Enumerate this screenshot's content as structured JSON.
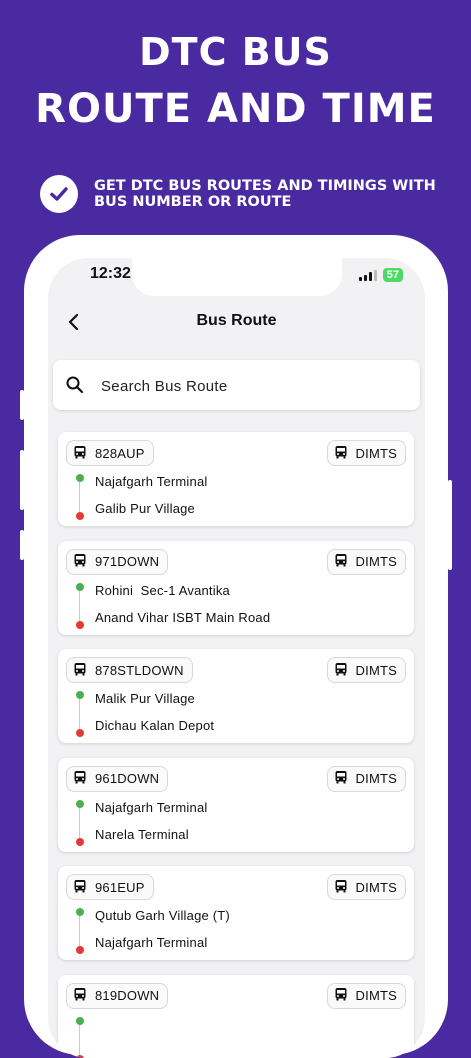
{
  "promo": {
    "title_line1": "DTC BUS",
    "title_line2": "ROUTE AND TIME",
    "subtitle": "GET DTC BUS ROUTES AND TIMINGS WITH BUS NUMBER OR ROUTE"
  },
  "status_bar": {
    "time": "12:32",
    "battery": "57"
  },
  "nav": {
    "title": "Bus Route"
  },
  "search": {
    "placeholder": "Search Bus Route"
  },
  "routes": [
    {
      "number": "828AUP",
      "operator": "DIMTS",
      "from": "Najafgarh Terminal",
      "to": "Galib Pur Village"
    },
    {
      "number": "971DOWN",
      "operator": "DIMTS",
      "from": "Rohini  Sec-1 Avantika",
      "to": "Anand Vihar ISBT Main Road"
    },
    {
      "number": "878STLDOWN",
      "operator": "DIMTS",
      "from": "Malik Pur Village",
      "to": "Dichau Kalan Depot"
    },
    {
      "number": "961DOWN",
      "operator": "DIMTS",
      "from": "Najafgarh Terminal",
      "to": "Narela Terminal"
    },
    {
      "number": "961EUP",
      "operator": "DIMTS",
      "from": "Qutub Garh Village (T)",
      "to": "Najafgarh Terminal"
    },
    {
      "number": "819DOWN",
      "operator": "DIMTS",
      "from": "",
      "to": ""
    }
  ],
  "colors": {
    "background": "#4a2aa0",
    "start_dot": "#4caf50",
    "end_dot": "#e53935",
    "battery": "#4cd964"
  }
}
